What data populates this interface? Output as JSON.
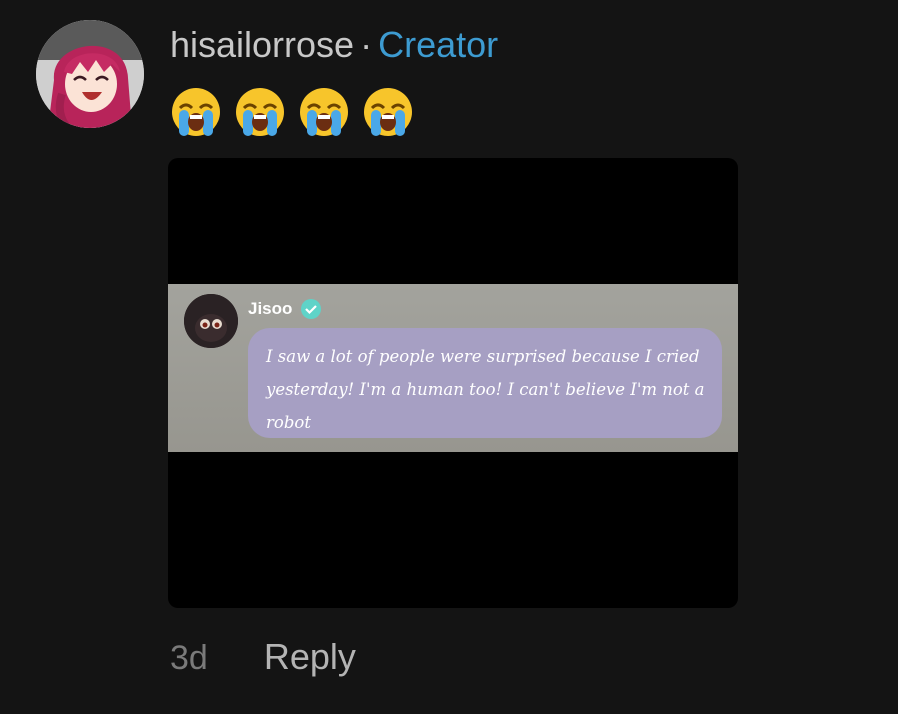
{
  "comment": {
    "username": "hisailorrose",
    "separator": "·",
    "badge": "Creator",
    "emojis": [
      "😭",
      "😭",
      "😭",
      "😭"
    ],
    "time": "3d",
    "reply_label": "Reply"
  },
  "attachment": {
    "author": "Jisoo",
    "verified_icon": "verified-check-icon",
    "text": "I saw a lot of people were surprised because I cried yesterday! I'm a human too! I can't believe I'm not a robot"
  },
  "colors": {
    "background": "#141414",
    "username": "#c8c8c8",
    "creator_badge": "#3d9bd1",
    "bubble": "#a69fc3",
    "verified": "#5fd3c8"
  }
}
